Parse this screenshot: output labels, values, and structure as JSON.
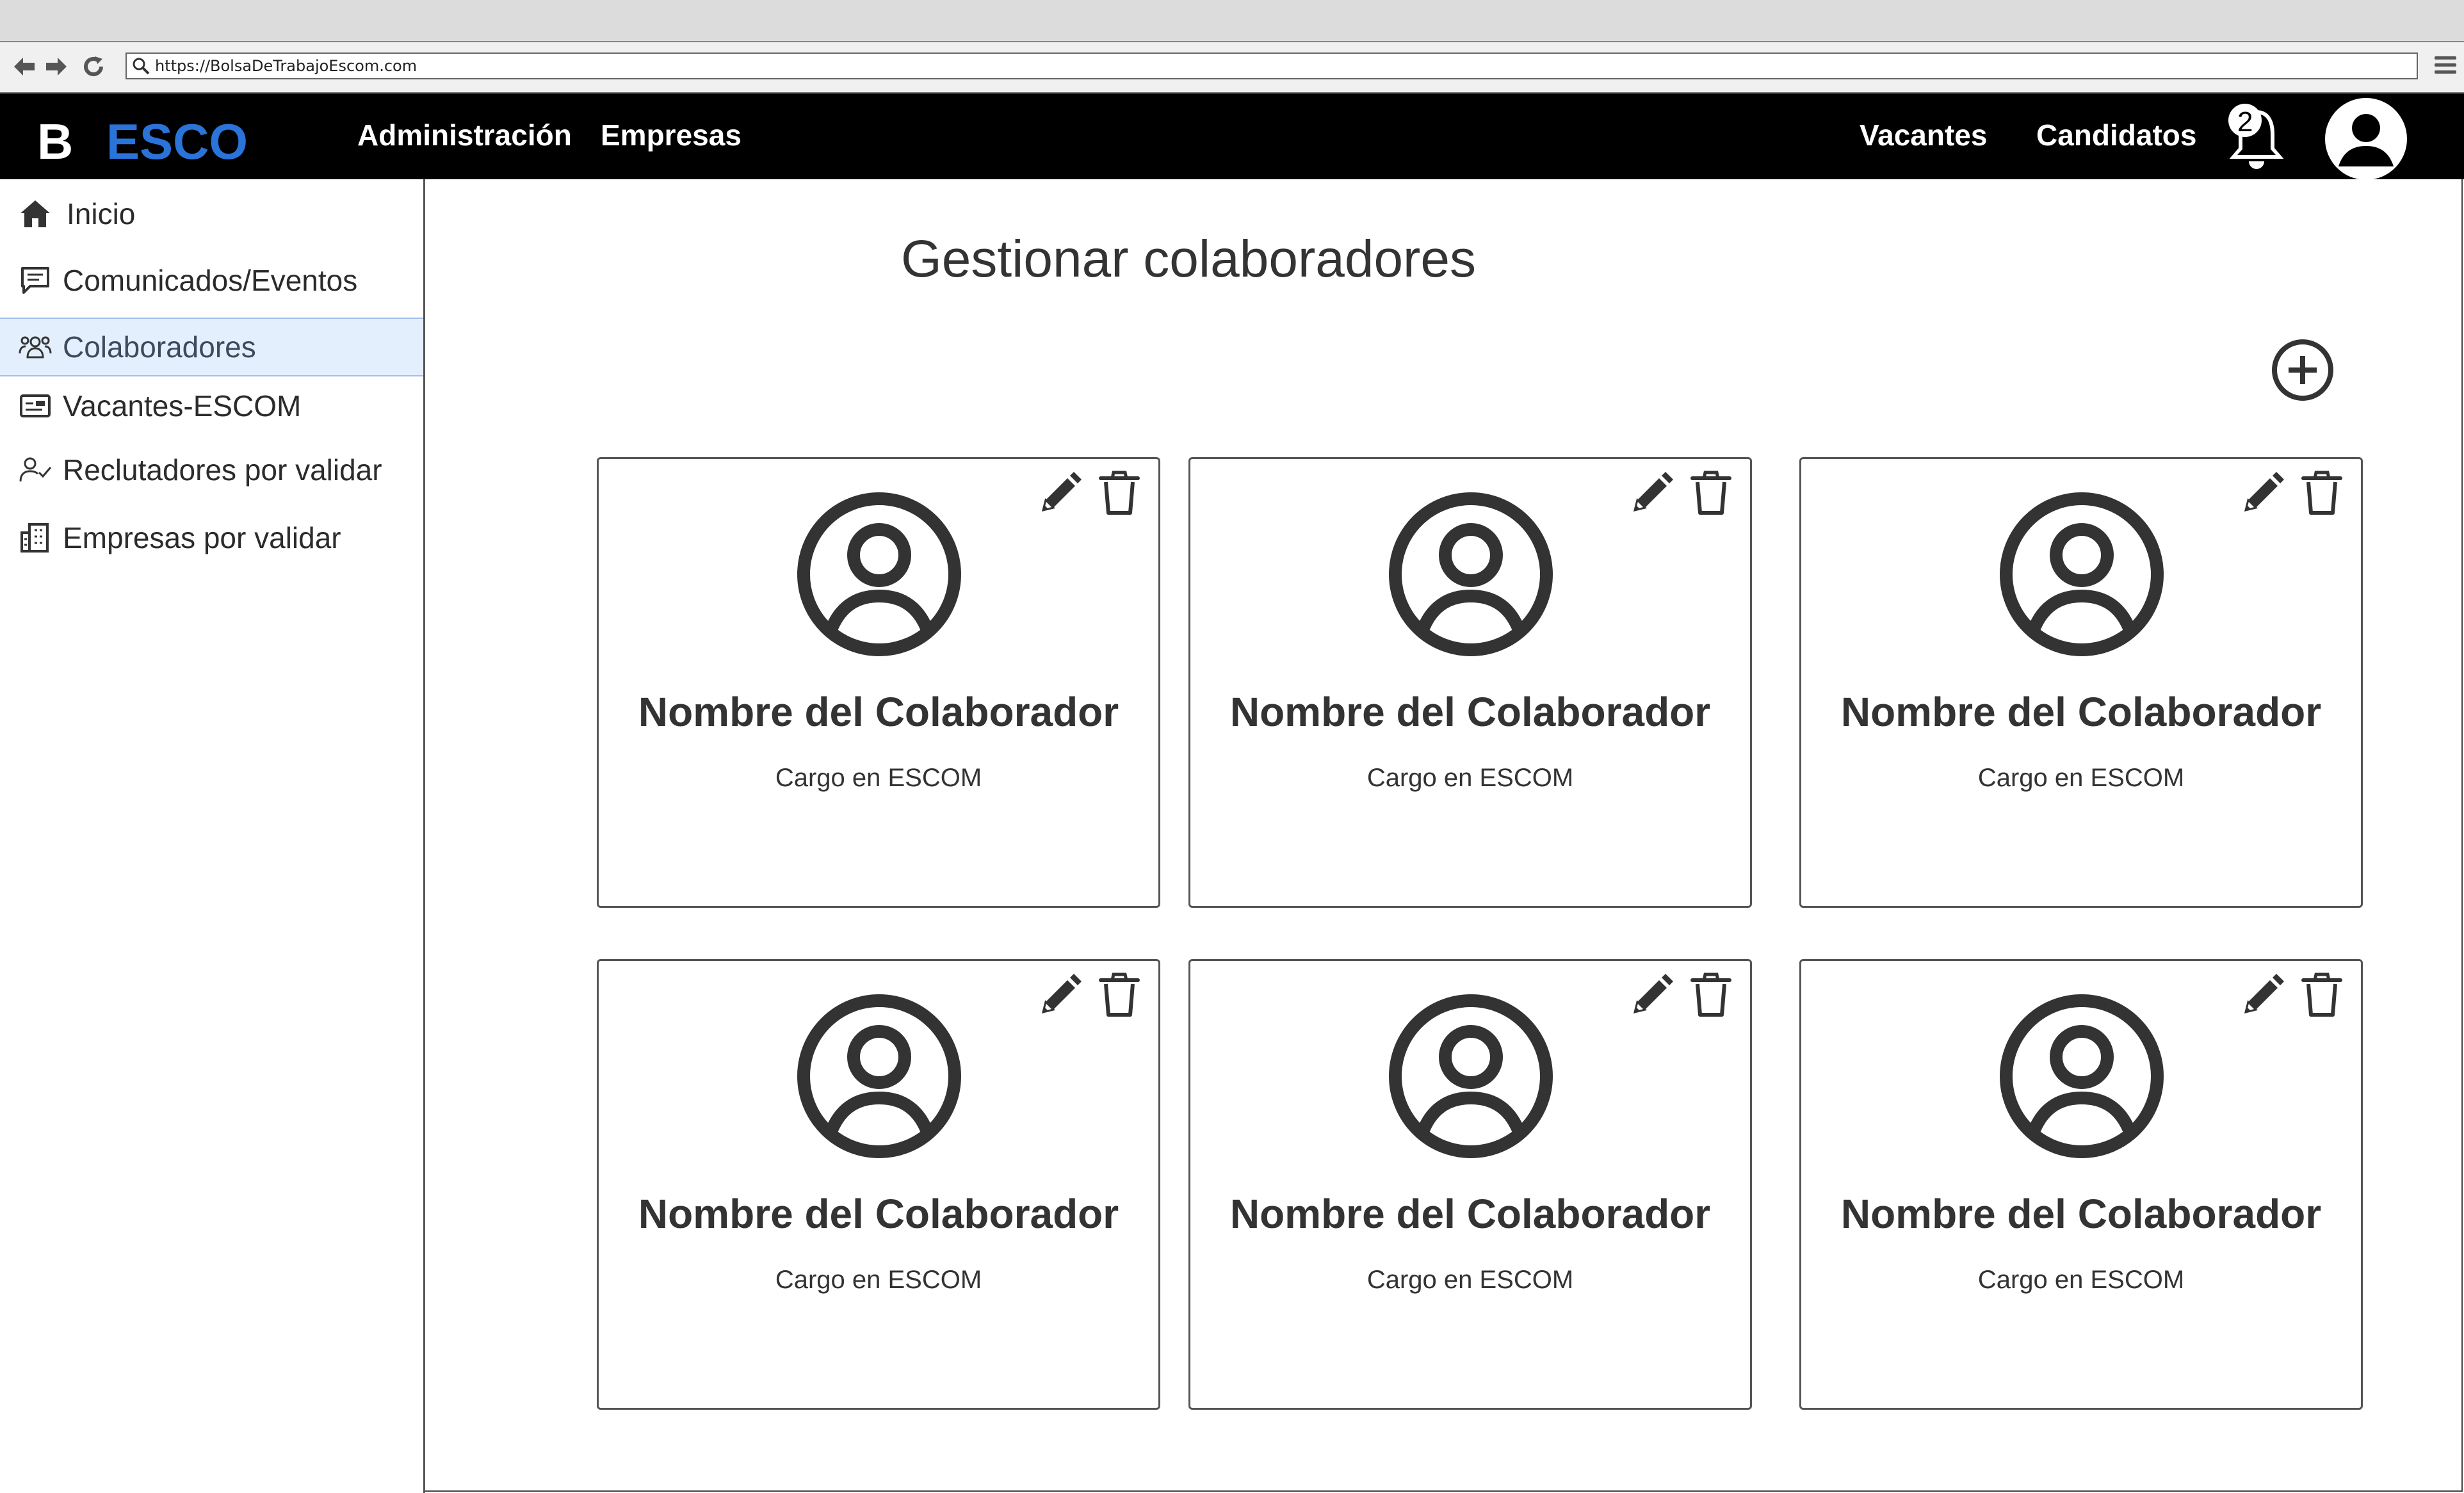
{
  "browser": {
    "url": "https://BolsaDeTrabajoEscom.com"
  },
  "header": {
    "logo_letter": "B",
    "logo_text": "ESCO",
    "logo_color": "#2a73d9",
    "nav_left": [
      {
        "label": "Administración"
      },
      {
        "label": "Empresas"
      }
    ],
    "nav_right": [
      {
        "label": "Vacantes"
      },
      {
        "label": "Candidatos"
      }
    ],
    "notification_count": "2"
  },
  "sidebar": {
    "items": [
      {
        "label": "Inicio",
        "icon": "home-icon",
        "active": false
      },
      {
        "label": "Comunicados/Eventos",
        "icon": "message-icon",
        "active": false
      },
      {
        "label": "Colaboradores",
        "icon": "people-icon",
        "active": true
      },
      {
        "label": "Vacantes-ESCOM",
        "icon": "vacancy-card-icon",
        "active": false
      },
      {
        "label": "Reclutadores por validar",
        "icon": "user-check-icon",
        "active": false
      },
      {
        "label": "Empresas por validar",
        "icon": "building-icon",
        "active": false
      }
    ],
    "active_bg": "#e4effd"
  },
  "main": {
    "title": "Gestionar colaboradores",
    "cards": [
      {
        "name": "Nombre del Colaborador",
        "role": "Cargo en ESCOM"
      },
      {
        "name": "Nombre del Colaborador",
        "role": "Cargo en ESCOM"
      },
      {
        "name": "Nombre del Colaborador",
        "role": "Cargo en ESCOM"
      },
      {
        "name": "Nombre del Colaborador",
        "role": "Cargo en ESCOM"
      },
      {
        "name": "Nombre del Colaborador",
        "role": "Cargo en ESCOM"
      },
      {
        "name": "Nombre del Colaborador",
        "role": "Cargo en ESCOM"
      }
    ]
  }
}
